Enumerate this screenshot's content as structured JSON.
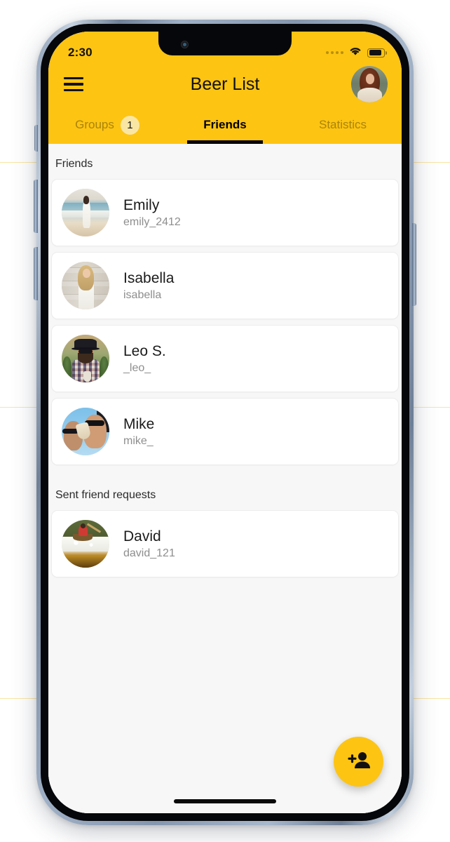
{
  "theme": {
    "accent_yellow": "#FDC412",
    "badge_yellow": "#FAE6A4",
    "screen_bg": "#F7F7F7",
    "card_bg": "#FFFFFF",
    "text_primary": "#1B1B1B",
    "text_secondary": "#8E8E8E"
  },
  "status_bar": {
    "time": "2:30",
    "signal_icon": "signal-dots-icon",
    "wifi_icon": "wifi-icon",
    "battery_icon": "battery-icon",
    "battery_level_pct": 88
  },
  "app_bar": {
    "menu_icon": "hamburger-menu-icon",
    "title": "Beer List",
    "profile_avatar_icon": "user-avatar-photo"
  },
  "tabs": [
    {
      "label": "Groups",
      "badge": "1",
      "active": false
    },
    {
      "label": "Friends",
      "badge": null,
      "active": true
    },
    {
      "label": "Statistics",
      "badge": null,
      "active": false
    }
  ],
  "sections": [
    {
      "header": "Friends",
      "rows": [
        {
          "name": "Emily",
          "handle": "emily_2412",
          "avatar_icon": "avatar-photo-beach"
        },
        {
          "name": "Isabella",
          "handle": "isabella",
          "avatar_icon": "avatar-photo-wall"
        },
        {
          "name": "Leo S.",
          "handle": "_leo_",
          "avatar_icon": "avatar-photo-hat"
        },
        {
          "name": "Mike",
          "handle": "mike_",
          "avatar_icon": "avatar-photo-sky"
        }
      ]
    },
    {
      "header": "Sent friend requests",
      "rows": [
        {
          "name": "David",
          "handle": "david_121",
          "avatar_icon": "avatar-photo-boat"
        }
      ]
    }
  ],
  "fab": {
    "icon": "person-add-icon",
    "label": "Add friend"
  },
  "home_indicator": "home-indicator-bar"
}
